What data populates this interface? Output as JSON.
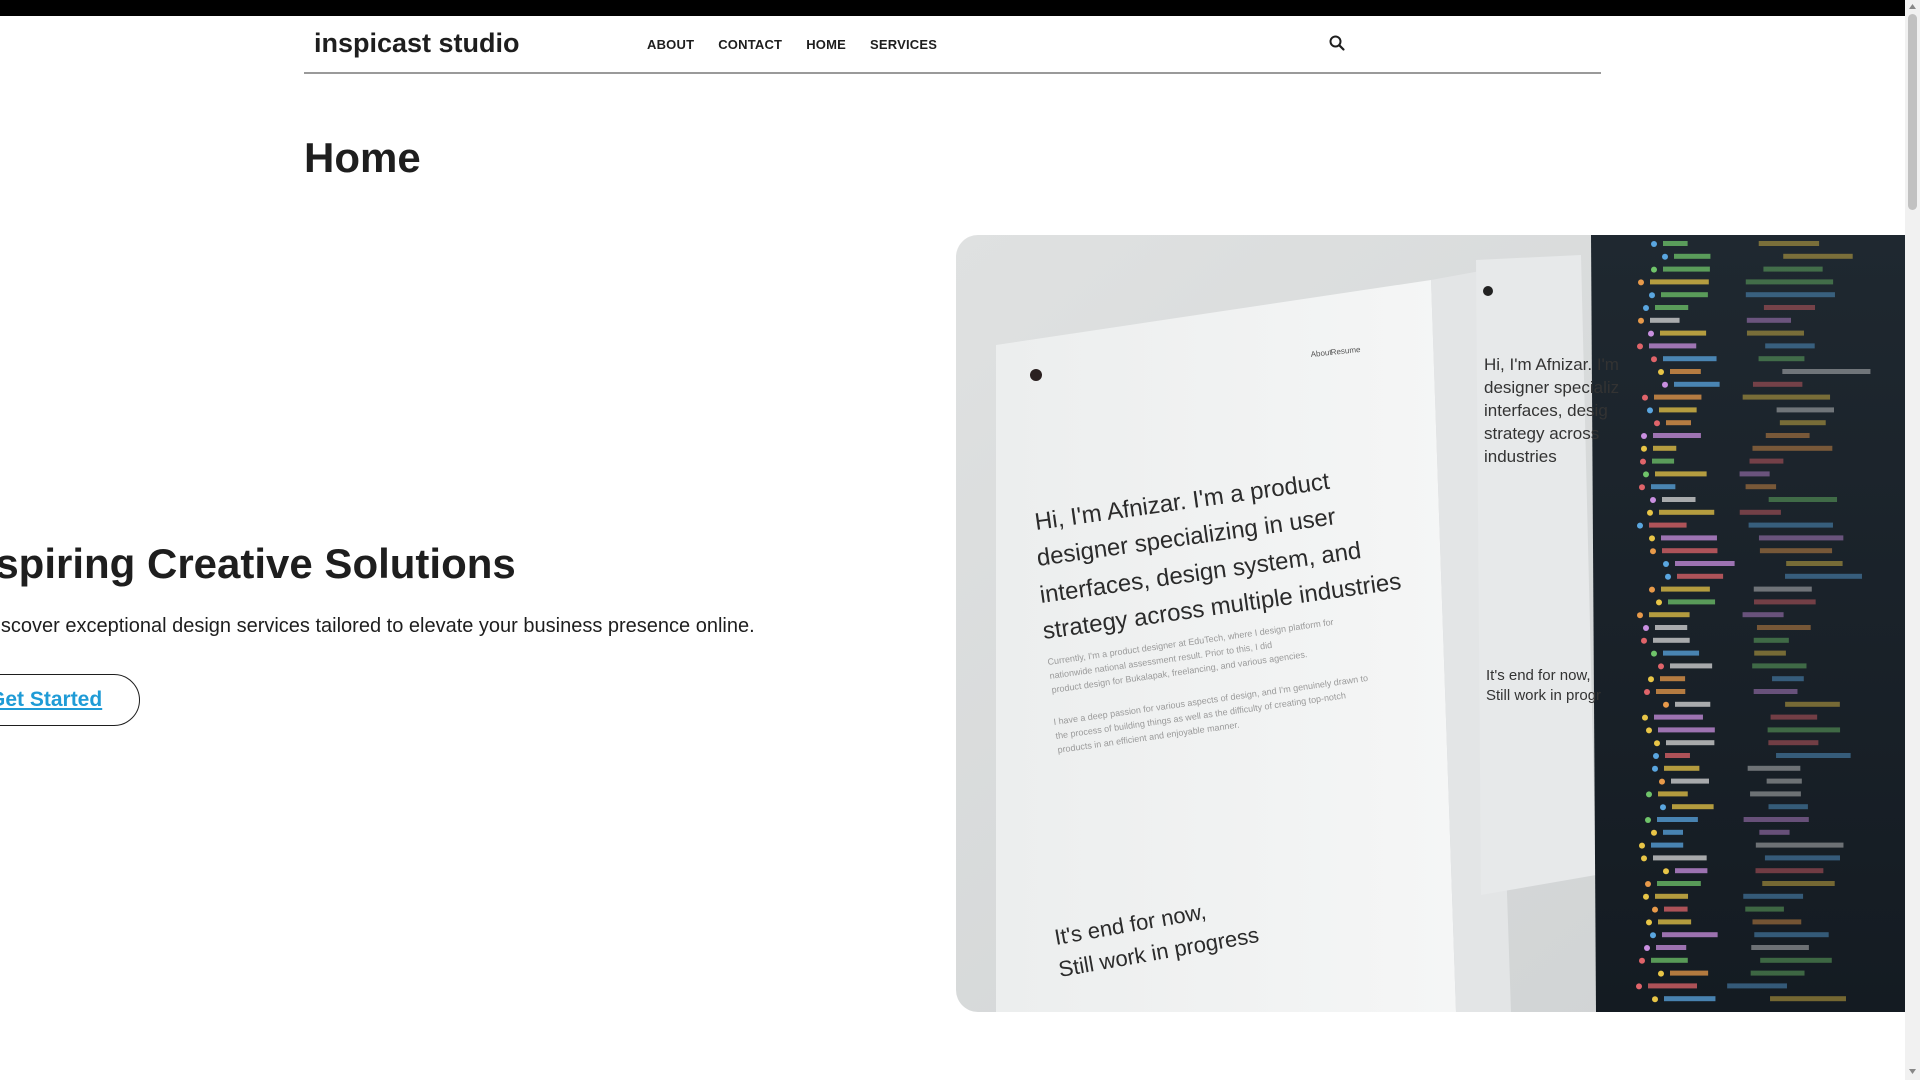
{
  "header": {
    "logo": "inspicast studio",
    "nav": [
      "ABOUT",
      "CONTACT",
      "HOME",
      "SERVICES"
    ],
    "search_icon": "search-icon"
  },
  "page": {
    "title": "Home"
  },
  "hero": {
    "heading": "Inspiring Creative Solutions",
    "text": "Discover exceptional design services tailored to elevate your business presence online.",
    "cta_label": "Get Started",
    "image": {
      "headline": "Hi, I'm Afnizar. I'm a product designer specializing in user interfaces, design system, and strategy across multiple industries",
      "footer": "It's end for now, Still work in progress",
      "side_headline": "Hi, I'm Afnizar. I'm a product designer specializing in user interfaces, design system, and strategy across multiple industries",
      "side_footer": "It's end for now, Still work in progress",
      "nav_left": "About",
      "nav_right": "Resume"
    }
  },
  "colors": {
    "text": "#1e1e1e",
    "link": "#1f9bd6",
    "topbar": "#000000",
    "divider": "#9a9a9a",
    "code_bg": "#1a222c"
  }
}
